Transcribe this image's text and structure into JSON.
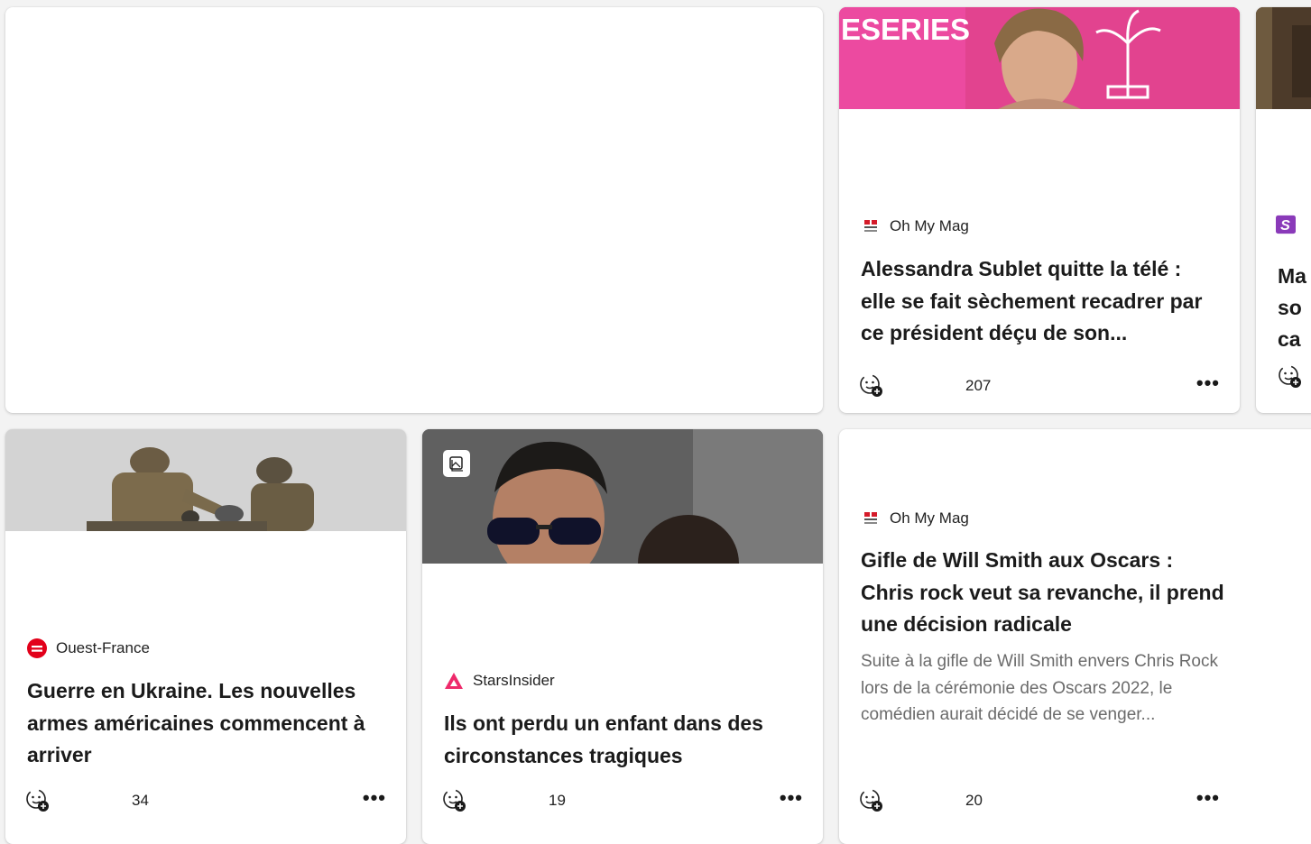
{
  "cards": [
    {
      "source": "Oh My Mag",
      "title": "Alessandra Sublet quitte la télé : elle se fait sèchement recadrer par ce président déçu de son...",
      "count": "207"
    },
    {
      "source": "Ouest-France",
      "title": "Guerre en Ukraine. Les nouvelles armes américaines commencent à arriver",
      "count": "34"
    },
    {
      "source": "StarsInsider",
      "title": "Ils ont perdu un enfant dans des circonstances tragiques",
      "count": "19"
    },
    {
      "source": "Oh My Mag",
      "title": "Gifle de Will Smith aux Oscars : Chris rock veut sa revanche, il prend une décision radicale",
      "abstract": "Suite à la gifle de Will Smith envers Chris Rock lors de la cérémonie des Oscars 2022, le comédien aurait décidé de se venger...",
      "count": "20"
    },
    {
      "title_partial_lines": [
        "Ma",
        "so",
        "ca"
      ]
    }
  ],
  "image_text": {
    "eseries_banner": "ESERIES"
  },
  "icons": {
    "react": "add-reaction-icon",
    "more": "more-options-icon",
    "gallery": "gallery-icon"
  },
  "colors": {
    "page_bg": "#f3f3f3",
    "card_bg": "#ffffff",
    "pink_banner": "#e53d95",
    "ouest_france_red": "#e2001a",
    "starsinsider_pink": "#ee2a6b",
    "partial_logo_purple": "#8a3ab9"
  }
}
